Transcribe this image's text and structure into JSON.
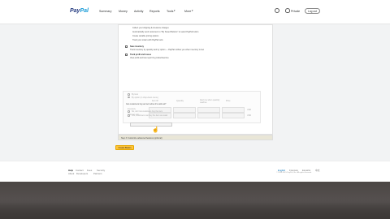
{
  "header": {
    "logo_pay": "Pay",
    "logo_pal": "Pal",
    "nav": [
      "Summary",
      "Money",
      "Activity",
      "Reports",
      "Tools",
      "More"
    ],
    "user_name": "Private",
    "logout_label": "Log out"
  },
  "form": {
    "bullets": [
      "Collect your shipping & insurance charges",
      "Automatically send customers to \"My Saved Buttons\" to select PayPal button",
      "Create variable pricing options",
      "Track your orders with PayPal tools"
    ],
    "option1_title": "Save inventory",
    "option1_desc": "Track inventory by quantity and by option — PayPal notifies you when inventory is low",
    "option2_title": "Track profit and losses",
    "option2_desc": "View profit and loss report by product/service",
    "subscription": {
      "label": "By Item",
      "sublabel": "By option (in drop-down menu)",
      "columns": [
        "Item ID",
        "Quantity",
        "Alert me when quantity reaches",
        "Price"
      ],
      "rows": [
        "Inventory",
        "Cost per unit"
      ],
      "units": [
        "USD",
        "USD"
      ]
    },
    "question": "Can customers buy an item when it's sold out?",
    "radio1": "No, don't let customers buy the item",
    "radio2": "Yes, customers can buy the item as usual",
    "url_placeholder": ""
  },
  "note": "Step 3: Customize advanced features (optional)",
  "save_label": "Create Button",
  "footer": {
    "links_row1": [
      "Help",
      "Contact",
      "Fees",
      "Security"
    ],
    "links_row2": [
      "About",
      "Developers",
      "Partners"
    ],
    "right_links": [
      "English",
      "Français",
      "Español",
      "中文"
    ],
    "copyright": "© 1999-2015 PayPal, Inc. All rights reserved."
  },
  "colors": {
    "accent": "#0070ba",
    "save_button": "#ffc439",
    "logo_dark": "#253b80",
    "logo_light": "#179bd7"
  }
}
